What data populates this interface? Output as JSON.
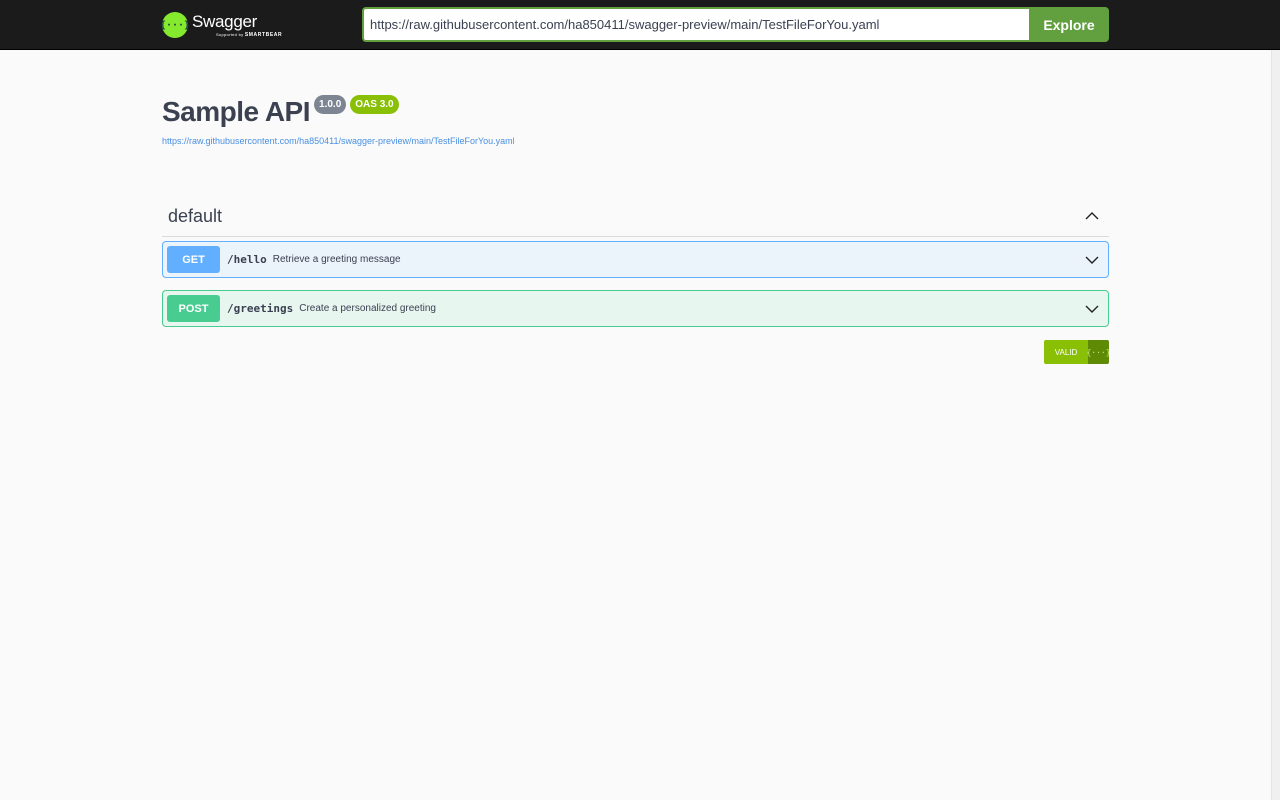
{
  "topbar": {
    "logo": {
      "name": "Swagger",
      "sub_prefix": "Supported by",
      "sub_brand": "SMARTBEAR",
      "mark": "{···}"
    },
    "url_value": "https://raw.githubusercontent.com/ha850411/swagger-preview/main/TestFileForYou.yaml",
    "explore_label": "Explore"
  },
  "info": {
    "title": "Sample API",
    "version": "1.0.0",
    "oas": "OAS 3.0",
    "spec_url": "https://raw.githubusercontent.com/ha850411/swagger-preview/main/TestFileForYou.yaml"
  },
  "tag": {
    "name": "default"
  },
  "operations": [
    {
      "method": "GET",
      "path": "/hello",
      "summary": "Retrieve a greeting message"
    },
    {
      "method": "POST",
      "path": "/greetings",
      "summary": "Create a personalized greeting"
    }
  ],
  "validator": {
    "label": "VALID",
    "icon": "{···}"
  },
  "colors": {
    "accent": "#62a03f",
    "get": "#61affe",
    "post": "#49cc90",
    "valid": "#89bf04"
  },
  "icons": {
    "collapse": "chevron-up-icon",
    "expand": "chevron-down-icon",
    "logo": "swagger-logo-icon"
  }
}
